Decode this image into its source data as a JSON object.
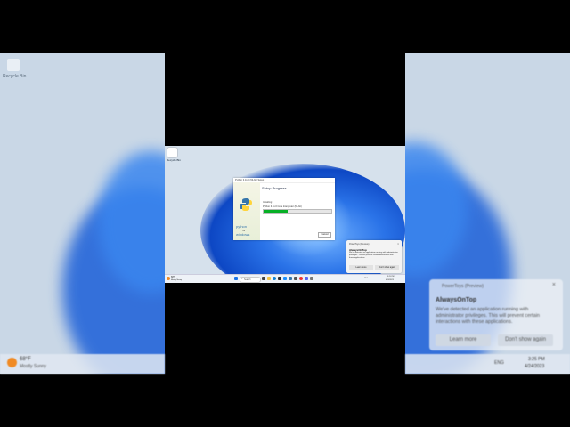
{
  "desktop": {
    "recycle_bin_label": "Recycle Bin"
  },
  "setup_window": {
    "title_bar": "Python 3.11.0 (64-bit) Setup",
    "heading": "Setup Progress",
    "status_text": "Installing:",
    "package_text": "Python 3.11.0 Core Interpreter (64-bit)",
    "progress_fraction": 0.35,
    "logo_text_1": "python",
    "logo_text_2": "for",
    "logo_text_3": "windows",
    "cancel_label": "Cancel"
  },
  "toast": {
    "app_name": "PowerToys (Preview)",
    "title": "AlwaysOnTop",
    "body": "We've detected an application running with administrator privileges. This will prevent certain interactions with these applications.",
    "learn_more": "Learn more",
    "dont_show": "Don't show again"
  },
  "taskbar": {
    "weather_temp": "68°F",
    "weather_desc": "Mostly Sunny",
    "search_placeholder": "Search",
    "language": "ENG",
    "time": "3:25 PM",
    "date": "4/24/2023"
  },
  "colors": {
    "accent_blue": "#1a5fd6",
    "progress_green": "#06b025",
    "python_blue": "#3776ab",
    "python_yellow": "#ffd43b"
  }
}
